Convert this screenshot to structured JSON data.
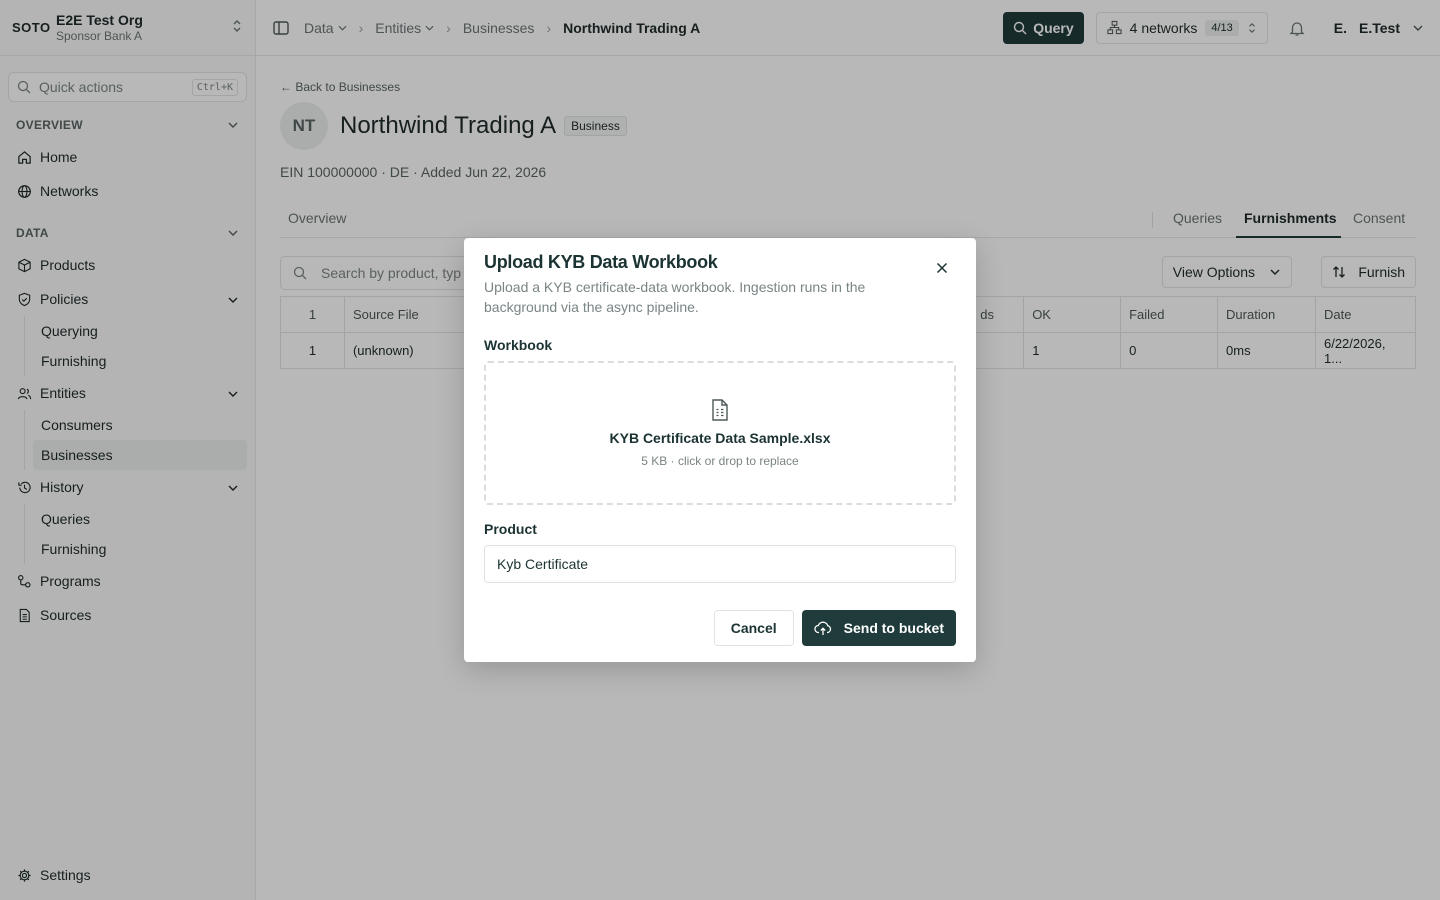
{
  "org": {
    "logo": "SOTO",
    "name": "E2E Test Org",
    "sub": "Sponsor Bank A"
  },
  "quick_actions": {
    "label": "Quick actions",
    "shortcut": "Ctrl+K"
  },
  "sidebar": {
    "overview_label": "OVERVIEW",
    "home": "Home",
    "networks": "Networks",
    "data_label": "DATA",
    "products": "Products",
    "policies": "Policies",
    "policies_sub": [
      "Querying",
      "Furnishing"
    ],
    "entities": "Entities",
    "entities_sub": [
      "Consumers",
      "Businesses"
    ],
    "history": "History",
    "history_sub": [
      "Queries",
      "Furnishing"
    ],
    "programs": "Programs",
    "sources": "Sources",
    "settings": "Settings"
  },
  "breadcrumb": [
    "Data",
    "Entities",
    "Businesses",
    "Northwind Trading A"
  ],
  "topbar": {
    "query": "Query",
    "networks": "4 networks",
    "networks_count": "4/13",
    "user_initial": "E.",
    "user_name": "E.Test"
  },
  "entity": {
    "back": "Back to Businesses",
    "initials": "NT",
    "name": "Northwind Trading A",
    "type_badge": "Business",
    "meta": "EIN 100000000 · DE · Added Jun 22, 2026"
  },
  "tabs": {
    "overview": "Overview",
    "queries": "Queries",
    "furnishments": "Furnishments",
    "consent": "Consent"
  },
  "toolbar": {
    "search_placeholder": "Search by product, typ",
    "view_options": "View Options",
    "furnish": "Furnish"
  },
  "table": {
    "headers": [
      "1",
      "Source File",
      "ds",
      "OK",
      "Failed",
      "Duration",
      "Date"
    ],
    "row": [
      "1",
      "(unknown)",
      "",
      "1",
      "0",
      "0ms",
      "6/22/2026, 1..."
    ]
  },
  "dialog": {
    "title": "Upload KYB Data Workbook",
    "description": "Upload a KYB certificate-data workbook. Ingestion runs in the background via the async pipeline.",
    "workbook_label": "Workbook",
    "file_name": "KYB Certificate Data Sample.xlsx",
    "file_meta": "5 KB · click or drop to replace",
    "product_label": "Product",
    "product_value": "Kyb Certificate",
    "cancel": "Cancel",
    "send": "Send to bucket"
  },
  "colors": {
    "primary": "#1f3b3b",
    "overlay": "rgba(0,0,0,0.28)"
  }
}
